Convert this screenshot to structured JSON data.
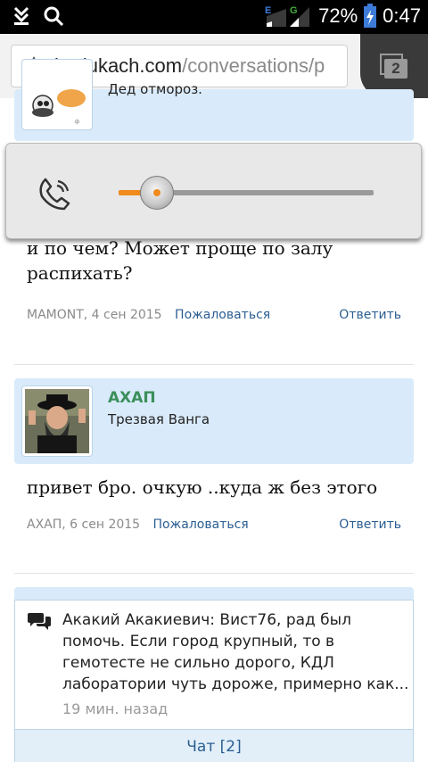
{
  "status_bar": {
    "battery_percent": "72%",
    "time": "0:47",
    "network_labels": [
      "E",
      "G"
    ],
    "icons": [
      "download-icon",
      "search-icon",
      "signal-icon",
      "battery-icon"
    ]
  },
  "browser": {
    "url_host": "budukach.com",
    "url_path": "/conversations/p",
    "tab_count": "2"
  },
  "volume_popup": {
    "icon": "phone-icon",
    "level": 0.15,
    "accent_color": "#f08a1c"
  },
  "posts": [
    {
      "author_name": "",
      "author_title": "Дед отмороз.",
      "message": [
        "и по чем? Может проще по залу",
        "распихать?"
      ],
      "meta_who": "MAMONT, 4 сен 2015",
      "report_label": "Пожаловаться",
      "reply_label": "Ответить"
    },
    {
      "author_name": "АХАП",
      "author_title": "Трезвая Ванга",
      "message": [
        "привет бро. очкую ..куда ж без этого"
      ],
      "meta_who": "АХАП, 6 сен 2015",
      "report_label": "Пожаловаться",
      "reply_label": "Ответить"
    }
  ],
  "chat": {
    "message": "Акакий Акакиевич: Вист76, рад был помочь. Если город крупный, то в гемотесте не сильно дорого, КДЛ лаборатории чуть дороже, примерно как...",
    "time": "19 мин. назад",
    "button_label": "Чат [2]"
  },
  "colors": {
    "author_green": "#3b8f5a",
    "link_blue": "#2b5e93",
    "header_bg": "#d9ebfb"
  }
}
